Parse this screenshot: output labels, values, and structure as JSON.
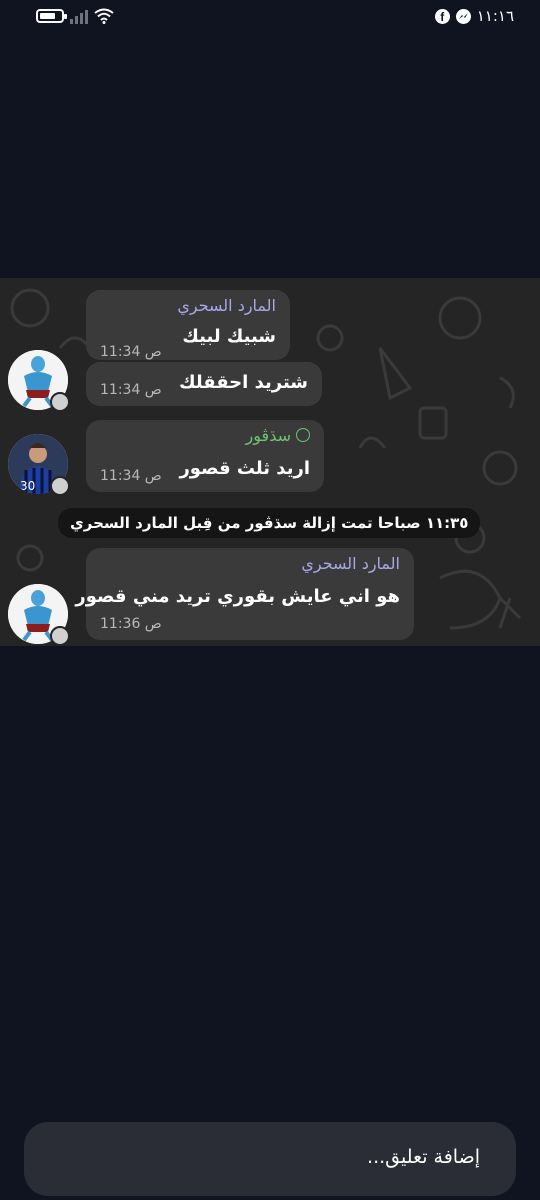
{
  "status_bar": {
    "time": "١١:١٦",
    "battery_level": 0.75,
    "icons": [
      "battery-icon",
      "signal-icon",
      "wifi-icon",
      "facebook-icon",
      "messenger-icon"
    ]
  },
  "chat": {
    "messages": [
      {
        "sender": "المارد السحري",
        "text": "شبيك لبيك",
        "time": "11:34 ص"
      },
      {
        "sender": "",
        "text": "شتريد احققلك",
        "time": "11:34 ص"
      },
      {
        "sender": "سڌڤور",
        "text": "اريد ثلث قصور",
        "time": "11:34 ص"
      },
      {
        "sender": "المارد السحري",
        "text": "هو اني عايش بقوري تريد مني قصور",
        "time": "11:36 ص"
      }
    ],
    "service_message": "١١:٣٥ صباحا تمت إزالة سڌڤور من قِبل المارد السحري",
    "colors": {
      "sender_purple": "#a7a8e6",
      "sender_green": "#6ec46f",
      "bubble": "#3a3a3a"
    }
  },
  "comment_bar": {
    "placeholder": "إضافة تعليق..."
  }
}
